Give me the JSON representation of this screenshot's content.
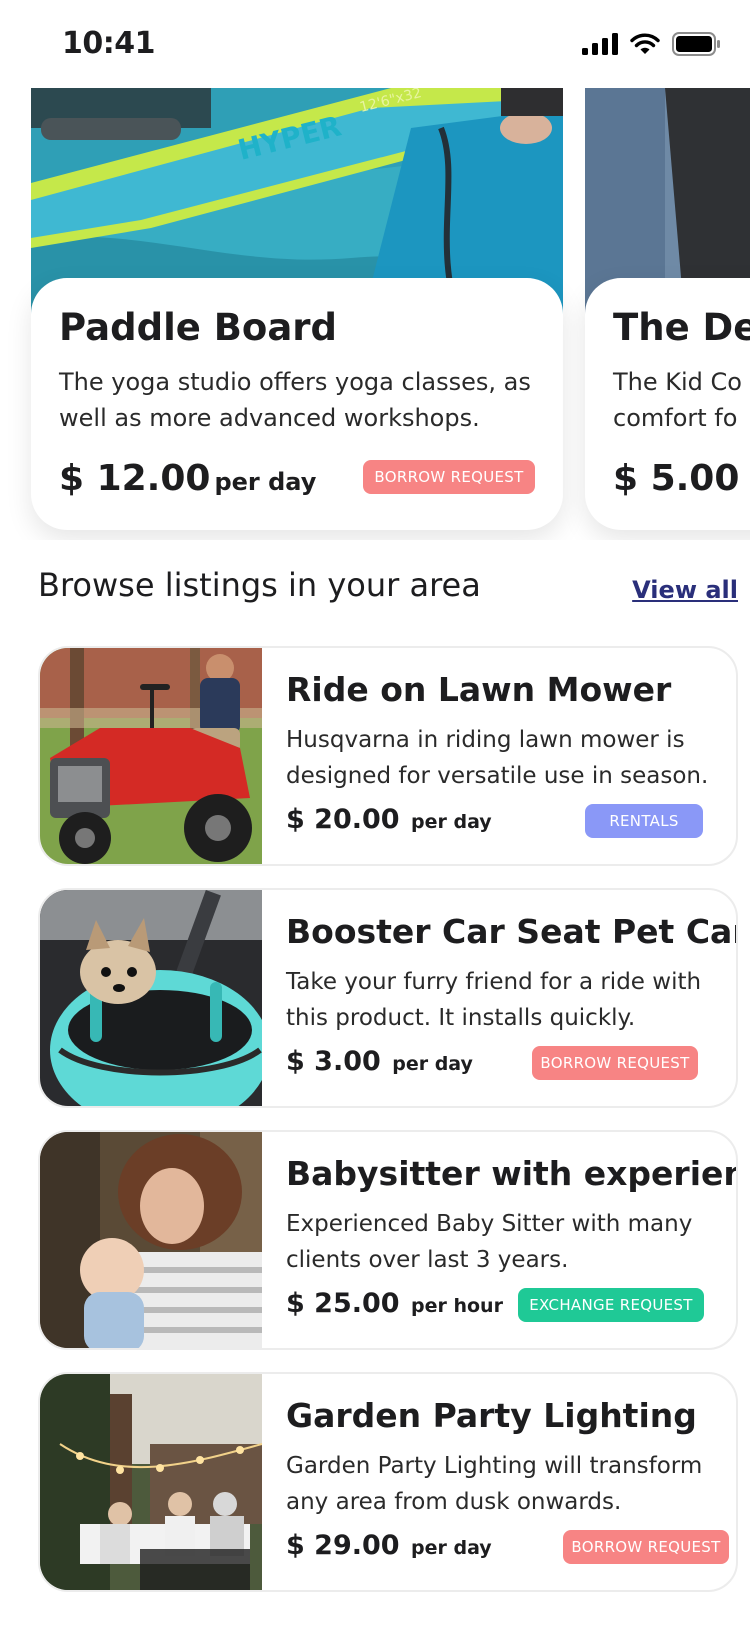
{
  "status_bar": {
    "time": "10:41"
  },
  "featured": [
    {
      "title": "Paddle Board",
      "description": "The yoga studio offers yoga classes, as well as more advanced workshops.",
      "price": "$ 12.00",
      "unit": "per day",
      "action": "BORROW REQUEST",
      "board_text": "HYPER",
      "board_text_2": "12'6\"x32"
    },
    {
      "title": "The De",
      "description": "The Kid Co comfort fo",
      "price": "$ 5.00"
    }
  ],
  "section": {
    "title": "Browse listings in your area",
    "view_all": "View all"
  },
  "listings": [
    {
      "title": "Ride on Lawn Mower",
      "description": "Husqvarna in riding lawn mower is designed for versatile use in season.",
      "price": "$ 20.00",
      "unit": "per day",
      "badge": "RENTALS",
      "badge_color": "#8a98f7"
    },
    {
      "title": "Booster Car Seat Pet Carrier",
      "description": "Take your furry friend for a ride with this product. It installs quickly.",
      "price": "$ 3.00",
      "unit": "per day",
      "badge": "BORROW REQUEST",
      "badge_color": "#f78484"
    },
    {
      "title": "Babysitter with experience",
      "description": "Experienced Baby Sitter with many clients over last 3 years.",
      "price": "$ 25.00",
      "unit": "per hour",
      "badge": "EXCHANGE REQUEST",
      "badge_color": "#1fc996"
    },
    {
      "title": "Garden Party Lighting",
      "description": "Garden Party Lighting will transform any area from dusk onwards.",
      "price": "$ 29.00",
      "unit": "per day",
      "badge": "BORROW REQUEST",
      "badge_color": "#f78484"
    }
  ]
}
